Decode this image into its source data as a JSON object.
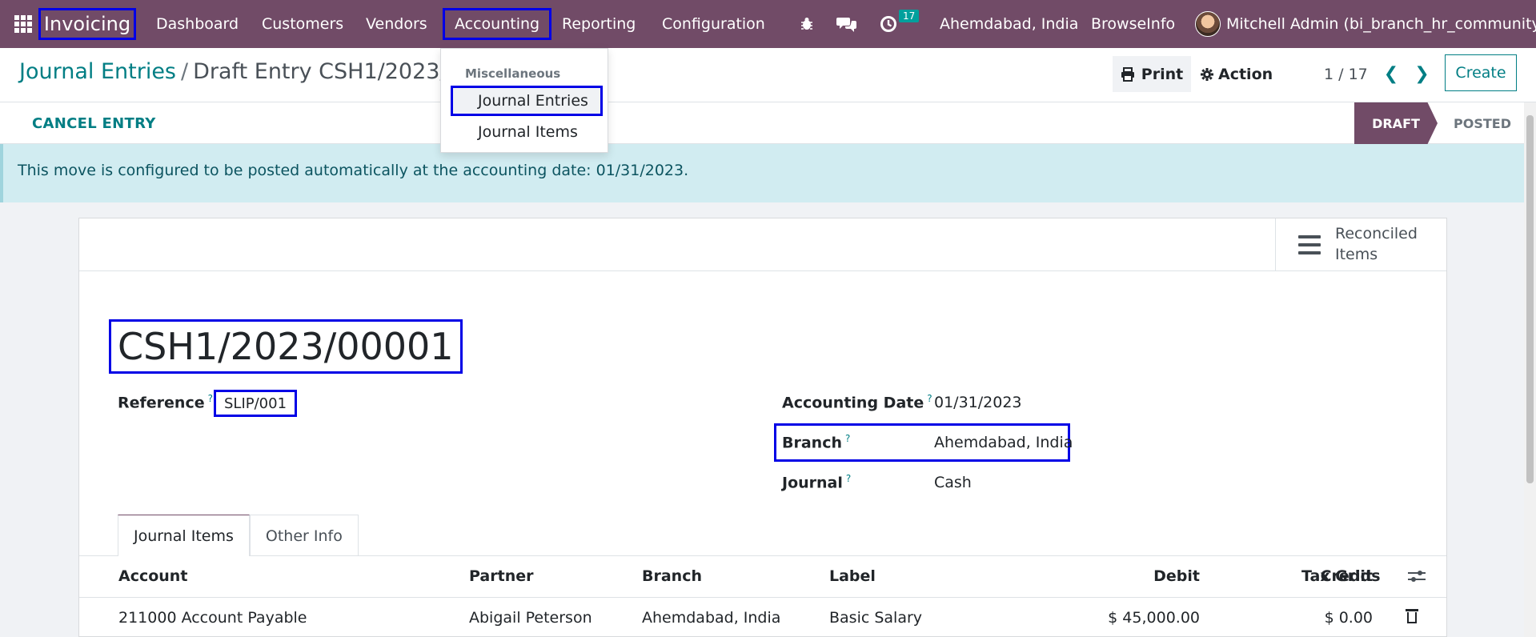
{
  "navbar": {
    "app_name": "Invoicing",
    "menu": [
      "Dashboard",
      "Customers",
      "Vendors",
      "Accounting",
      "Reporting",
      "Configuration"
    ],
    "activity_count": "17",
    "company": "Ahemdabad, India",
    "browse_info": "BrowseInfo",
    "user": "Mitchell Admin (bi_branch_hr_community)"
  },
  "dropdown": {
    "header": "Miscellaneous",
    "items": [
      "Journal Entries",
      "Journal Items"
    ]
  },
  "control": {
    "breadcrumb_parent": "Journal Entries",
    "breadcrumb_sep": "/",
    "breadcrumb_current": "Draft Entry CSH1/2023/00",
    "print_label": "Print",
    "action_label": "Action",
    "pager": "1 / 17",
    "create_label": "Create"
  },
  "status": {
    "cancel_label": "CANCEL ENTRY",
    "stages": [
      "DRAFT",
      "POSTED"
    ],
    "active_stage": "DRAFT"
  },
  "alert": {
    "text": "This move is configured to be posted automatically at the accounting date: 01/31/2023."
  },
  "form": {
    "reconciled_label_line1": "Reconciled",
    "reconciled_label_line2": "Items",
    "name": "CSH1/2023/00001",
    "reference_label": "Reference",
    "reference_value": "SLIP/001",
    "accounting_date_label": "Accounting Date",
    "accounting_date_value": "01/31/2023",
    "branch_label": "Branch",
    "branch_value": "Ahemdabad, India",
    "journal_label": "Journal",
    "journal_value": "Cash",
    "help_mark": "?"
  },
  "tabs": [
    "Journal Items",
    "Other Info"
  ],
  "table": {
    "headers": [
      "Account",
      "Partner",
      "Branch",
      "Label",
      "Debit",
      "Credit",
      "Tax Grids"
    ],
    "rows": [
      [
        "211000 Account Payable",
        "Abigail Peterson",
        "Ahemdabad, India",
        "Basic Salary",
        "$ 45,000.00",
        "$ 0.00",
        ""
      ]
    ]
  },
  "colors": {
    "brand": "#714b67",
    "accent": "#017e84",
    "highlight_box": "#0000e6",
    "alert_bg": "#d1ecf1"
  }
}
